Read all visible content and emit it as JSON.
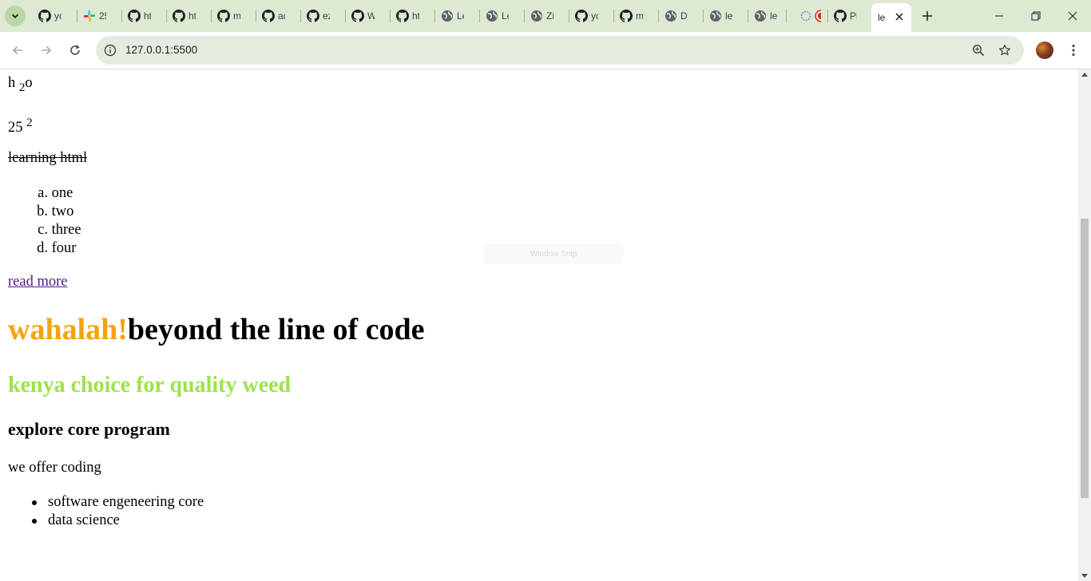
{
  "browser": {
    "tabs": [
      {
        "title": "yc",
        "icon": "github"
      },
      {
        "title": "25",
        "icon": "slack"
      },
      {
        "title": "ht",
        "icon": "github"
      },
      {
        "title": "ht",
        "icon": "github"
      },
      {
        "title": "m",
        "icon": "github"
      },
      {
        "title": "ac",
        "icon": "github"
      },
      {
        "title": "ez",
        "icon": "github"
      },
      {
        "title": "W",
        "icon": "github"
      },
      {
        "title": "ht",
        "icon": "github"
      },
      {
        "title": "Le",
        "icon": "globe"
      },
      {
        "title": "Le",
        "icon": "globe"
      },
      {
        "title": "Zi",
        "icon": "globe"
      },
      {
        "title": "yc",
        "icon": "github"
      },
      {
        "title": "m",
        "icon": "github"
      },
      {
        "title": "D",
        "icon": "globe"
      },
      {
        "title": "le",
        "icon": "globe"
      },
      {
        "title": "le",
        "icon": "globe"
      },
      {
        "title": "",
        "icon": "extension-record"
      },
      {
        "title": "Pi",
        "icon": "github"
      }
    ],
    "active_tab": {
      "title": "le"
    },
    "url": "127.0.0.1:5500",
    "accent_color": "#dde9d3",
    "omnibox_color": "#e4ecdf"
  },
  "page": {
    "h2o_base": "h ",
    "h2o_sub": "2",
    "h2o_tail": "o",
    "square_base": "25 ",
    "square_sup": "2",
    "strike_text": "learning html",
    "ordered_list": [
      {
        "marker": "a.",
        "text": "one"
      },
      {
        "marker": "b.",
        "text": "two"
      },
      {
        "marker": "c.",
        "text": "three"
      },
      {
        "marker": "d.",
        "text": "four"
      }
    ],
    "link_text": "read more",
    "heading1_accent": "wahalah!",
    "heading1_rest": "beyond the line of code",
    "heading1_accent_color": "#f5a30a",
    "heading2": "kenya choice for quality weed",
    "heading2_color": "#9ee34a",
    "heading3": "explore core program",
    "offer_text": "we offer coding",
    "unordered_list": [
      "software engeneering core",
      "data science"
    ],
    "overlay_text": "Window Snip"
  }
}
